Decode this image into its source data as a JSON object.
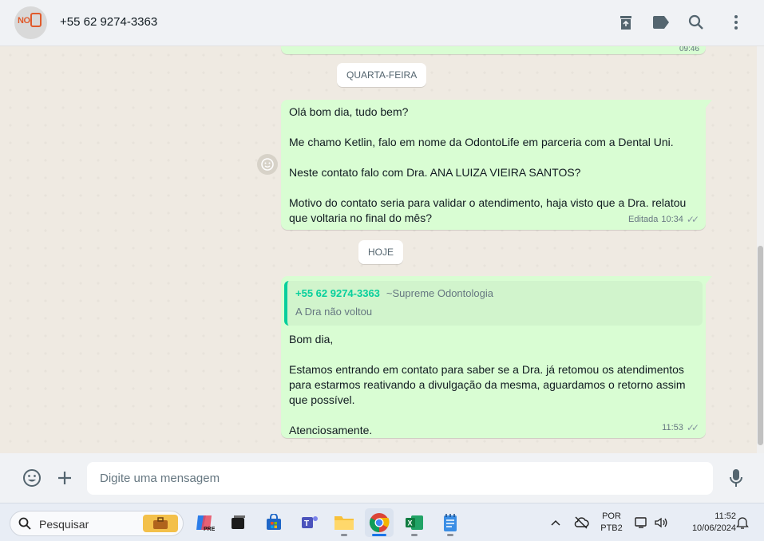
{
  "header": {
    "contact_name": "+55 62 9274-3363",
    "avatar_text": "NO",
    "actions": [
      "archive-icon",
      "label-icon",
      "search-icon",
      "menu-icon"
    ]
  },
  "chat": {
    "previous_time": "09:46",
    "day_labels": {
      "wednesday": "QUARTA-FEIRA",
      "today": "HOJE"
    },
    "message1": {
      "text": "Olá bom dia, tudo bem?\n\nMe chamo Ketlin, falo em nome da OdontoLife em parceria com a Dental Uni.\n\nNeste contato falo com Dra. ANA LUIZA VIEIRA SANTOS?\n\nMotivo do contato seria para validar o atendimento, haja visto que a Dra. relatou que voltaria no final do mês?",
      "edited_label": "Editada",
      "time": "10:34",
      "status": "read-ticks"
    },
    "message2": {
      "quote_author": "+55 62 9274-3363",
      "quote_sender_name": "~Supreme Odontologia",
      "quote_text": "A Dra não voltou",
      "text": "Bom dia,\n\nEstamos entrando em contato para saber se a Dra. já retomou os atendimentos para estarmos reativando a divulgação da mesma, aguardamos o retorno assim que possível.\n\nAtenciosamente.",
      "time": "11:53",
      "status": "read-ticks"
    }
  },
  "composer": {
    "placeholder": "Digite uma mensagem",
    "value": ""
  },
  "taskbar": {
    "search_label": "Pesquisar",
    "apps": [
      "briefcase-icon",
      "copilot-icon",
      "task-view-icon",
      "store-icon",
      "teams-icon",
      "file-explorer-icon",
      "chrome-icon",
      "excel-icon",
      "notepad-icon"
    ],
    "language_line1": "POR",
    "language_line2": "PTB2",
    "time": "11:52",
    "date": "10/06/2024"
  },
  "colors": {
    "bubble_outgoing": "#d9fdd3",
    "chat_background": "#efeae2",
    "quote_accent": "#06cf9c"
  }
}
